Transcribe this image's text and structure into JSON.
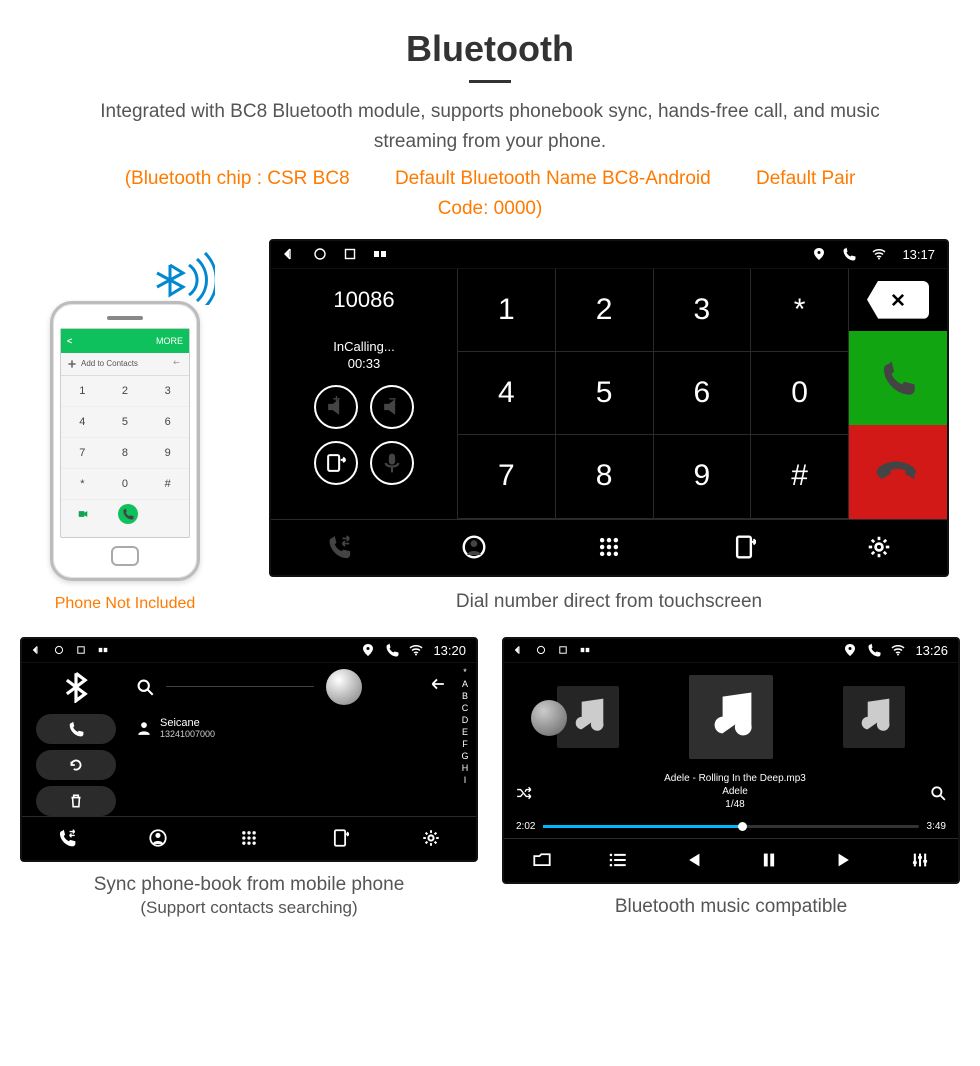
{
  "page": {
    "title": "Bluetooth",
    "subtitle": "Integrated with BC8 Bluetooth module, supports phonebook sync, hands-free call, and music streaming from your phone.",
    "spec_chip": "(Bluetooth chip : CSR BC8",
    "spec_name": "Default Bluetooth Name BC8-Android",
    "spec_code": "Default Pair Code: 0000)"
  },
  "phone": {
    "more_label": "MORE",
    "add_label": "Add to Contacts",
    "keys": [
      "1",
      "2",
      "3",
      "4",
      "5",
      "6",
      "7",
      "8",
      "9",
      "*",
      "0",
      "#"
    ],
    "caption": "Phone Not Included"
  },
  "dial": {
    "status": {
      "time": "13:17"
    },
    "number": "10086",
    "calling_label": "InCalling...",
    "timer": "00:33",
    "keys": [
      "1",
      "2",
      "3",
      "*",
      "4",
      "5",
      "6",
      "0",
      "7",
      "8",
      "9",
      "#"
    ],
    "caption": "Dial number direct from touchscreen"
  },
  "phonebook": {
    "status": {
      "time": "13:20"
    },
    "contact": {
      "name": "Seicane",
      "number": "13241007000"
    },
    "alpha": [
      "*",
      "A",
      "B",
      "C",
      "D",
      "E",
      "F",
      "G",
      "H",
      "I"
    ],
    "caption_line1": "Sync phone-book from mobile phone",
    "caption_line2": "(Support contacts searching)"
  },
  "music": {
    "status": {
      "time": "13:26"
    },
    "track_file": "Adele - Rolling In the Deep.mp3",
    "track_artist": "Adele",
    "track_index": "1/48",
    "elapsed": "2:02",
    "total": "3:49",
    "progress_pct": 53,
    "caption": "Bluetooth music compatible"
  }
}
